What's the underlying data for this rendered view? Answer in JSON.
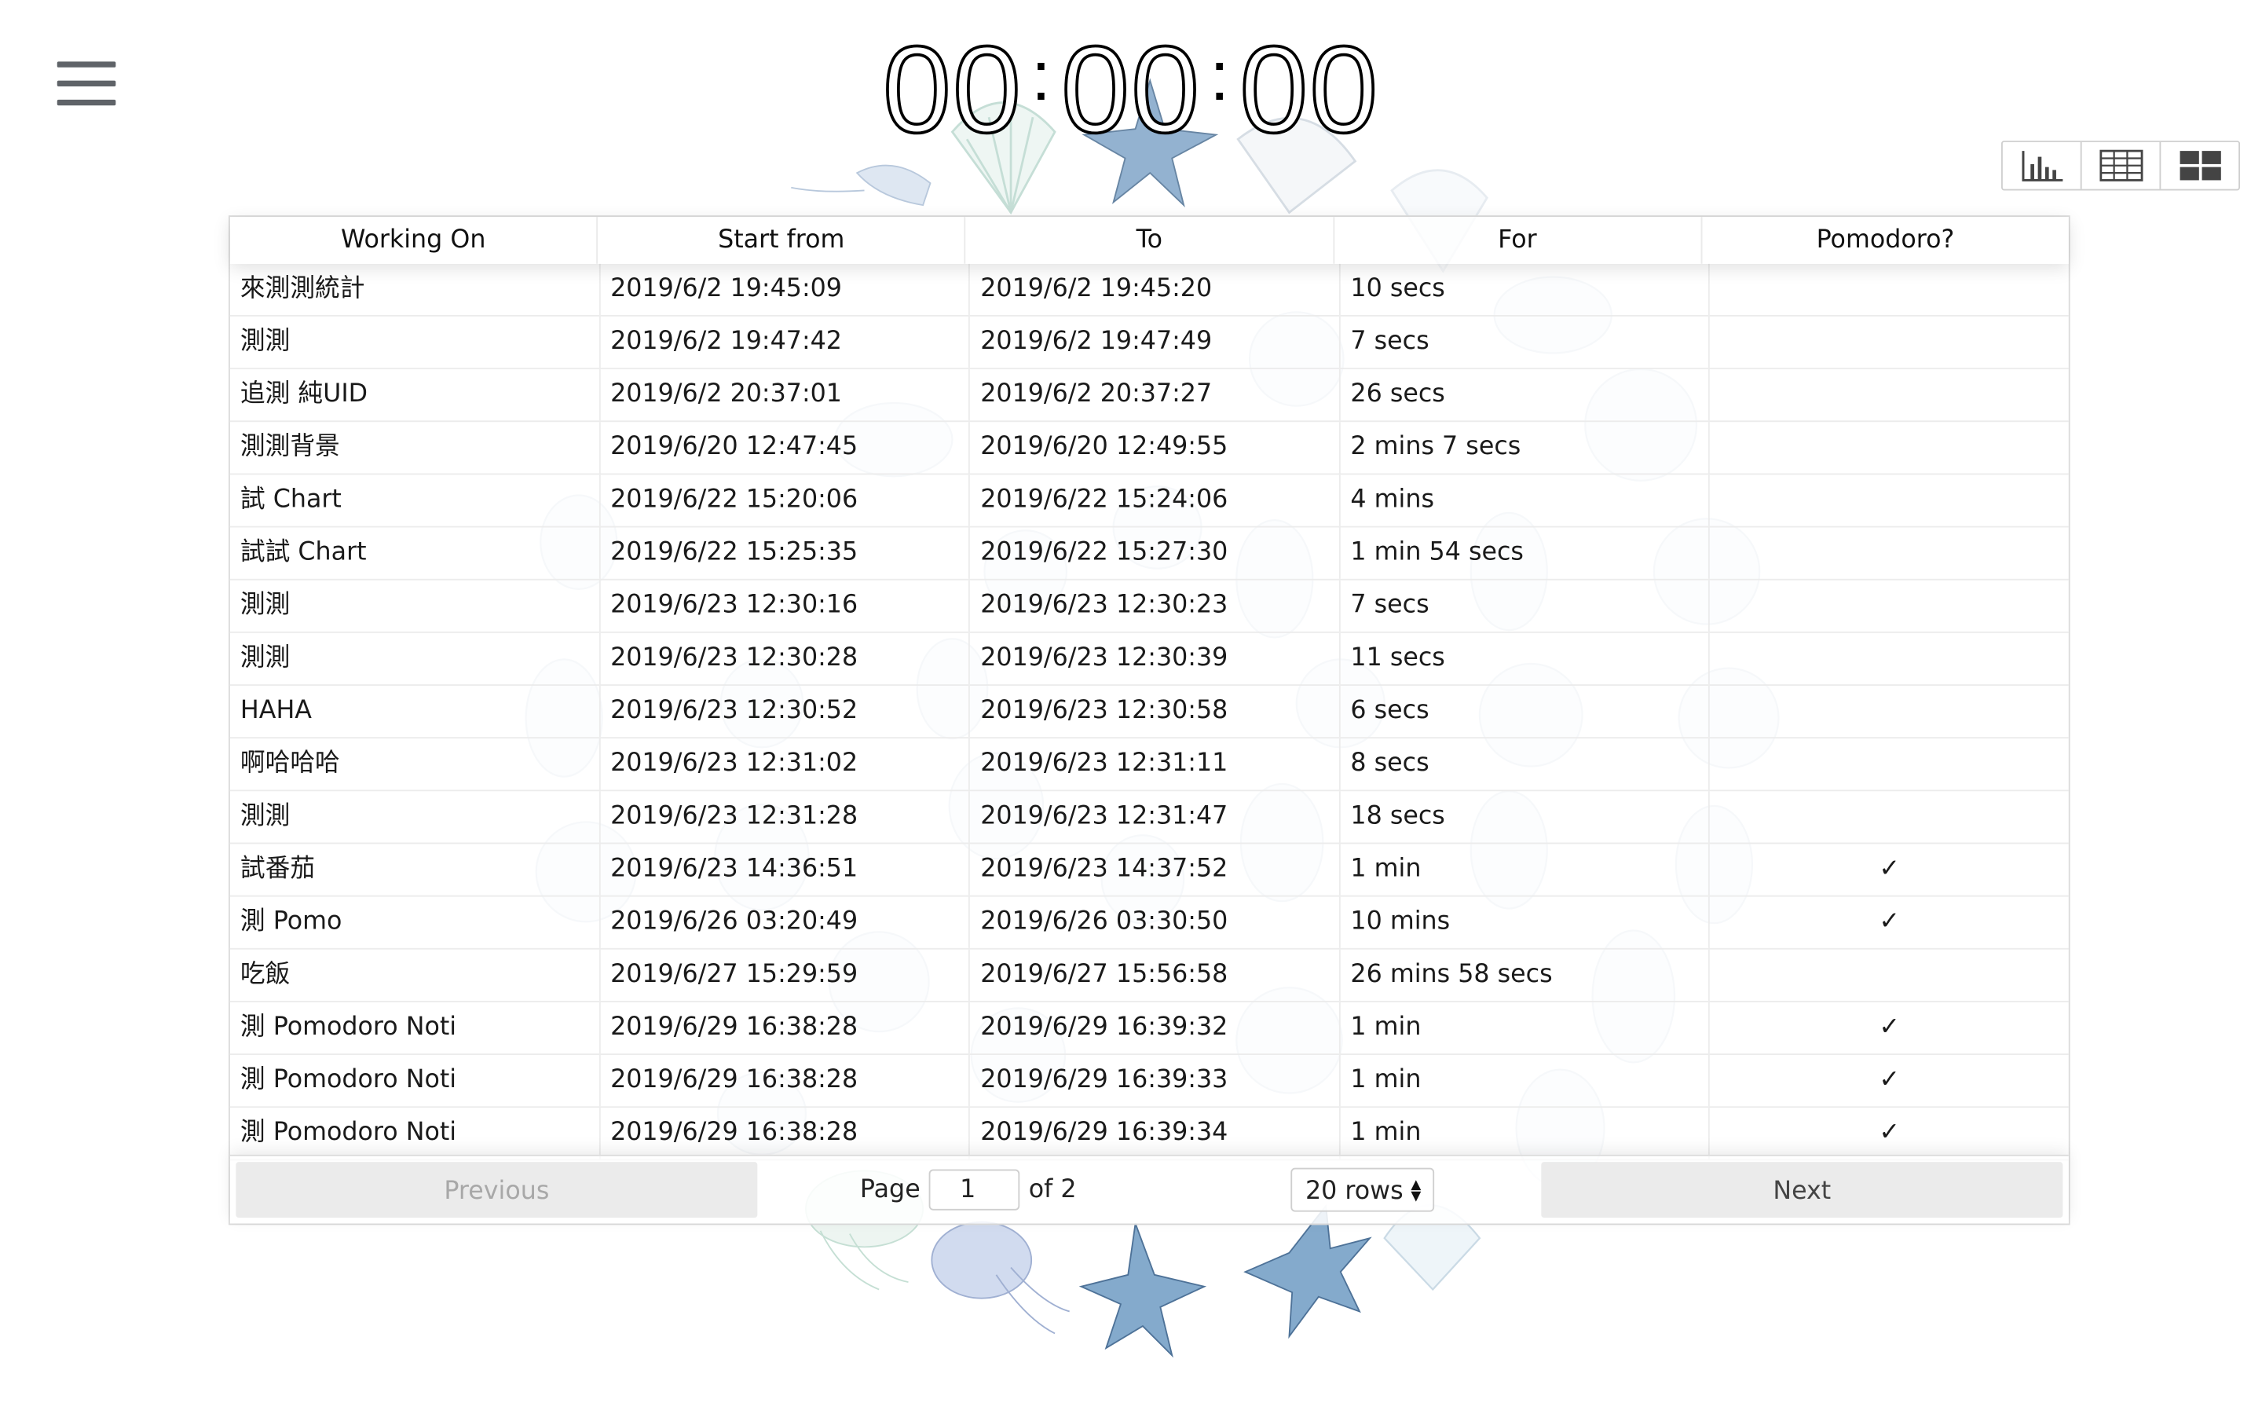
{
  "timer": {
    "h": "00",
    "m": "00",
    "s": "00",
    "sep": ":"
  },
  "views": [
    {
      "icon": "bar-chart-icon"
    },
    {
      "icon": "table-icon"
    },
    {
      "icon": "grid-icon"
    }
  ],
  "table": {
    "headers": [
      "Working On",
      "Start from",
      "To",
      "For",
      "Pomodoro?"
    ],
    "rows": [
      [
        "來測測統計",
        "2019/6/2 19:45:09",
        "2019/6/2 19:45:20",
        "10 secs",
        ""
      ],
      [
        "測測",
        "2019/6/2 19:47:42",
        "2019/6/2 19:47:49",
        "7 secs",
        ""
      ],
      [
        "追測 純UID",
        "2019/6/2 20:37:01",
        "2019/6/2 20:37:27",
        "26 secs",
        ""
      ],
      [
        "測測背景",
        "2019/6/20 12:47:45",
        "2019/6/20 12:49:55",
        "2 mins 7 secs",
        ""
      ],
      [
        "試 Chart",
        "2019/6/22 15:20:06",
        "2019/6/22 15:24:06",
        "4 mins",
        ""
      ],
      [
        "試試 Chart",
        "2019/6/22 15:25:35",
        "2019/6/22 15:27:30",
        "1 min 54 secs",
        ""
      ],
      [
        "測測",
        "2019/6/23 12:30:16",
        "2019/6/23 12:30:23",
        "7 secs",
        ""
      ],
      [
        "測測",
        "2019/6/23 12:30:28",
        "2019/6/23 12:30:39",
        "11 secs",
        ""
      ],
      [
        "HAHA",
        "2019/6/23 12:30:52",
        "2019/6/23 12:30:58",
        "6 secs",
        ""
      ],
      [
        "啊哈哈哈",
        "2019/6/23 12:31:02",
        "2019/6/23 12:31:11",
        "8 secs",
        ""
      ],
      [
        "測測",
        "2019/6/23 12:31:28",
        "2019/6/23 12:31:47",
        "18 secs",
        ""
      ],
      [
        "試番茄",
        "2019/6/23 14:36:51",
        "2019/6/23 14:37:52",
        "1 min",
        "✓"
      ],
      [
        "測 Pomo",
        "2019/6/26 03:20:49",
        "2019/6/26 03:30:50",
        "10 mins",
        "✓"
      ],
      [
        "吃飯",
        "2019/6/27 15:29:59",
        "2019/6/27 15:56:58",
        "26 mins 58 secs",
        ""
      ],
      [
        "測 Pomodoro Noti",
        "2019/6/29 16:38:28",
        "2019/6/29 16:39:32",
        "1 min",
        "✓"
      ],
      [
        "測 Pomodoro Noti",
        "2019/6/29 16:38:28",
        "2019/6/29 16:39:33",
        "1 min",
        "✓"
      ],
      [
        "測 Pomodoro Noti",
        "2019/6/29 16:38:28",
        "2019/6/29 16:39:34",
        "1 min",
        "✓"
      ]
    ]
  },
  "pagination": {
    "previous": "Previous",
    "next": "Next",
    "page_label": "Page",
    "page_value": "1",
    "of_label": "of 2",
    "rows_label": "20 rows"
  },
  "colors": {
    "decor_blue": "#8aa6c8",
    "decor_teal": "#9cc9b8",
    "decor_star": "#4b7fa8"
  }
}
